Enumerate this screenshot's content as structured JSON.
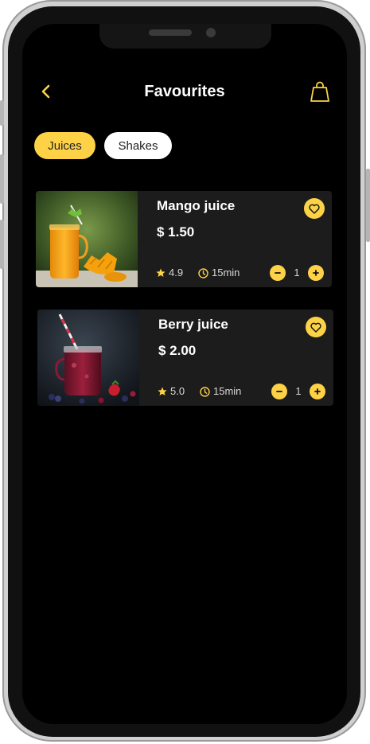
{
  "header": {
    "title": "Favourites",
    "back_icon": "chevron-left-icon",
    "bag_icon": "shopping-bag-icon"
  },
  "tabs": [
    {
      "label": "Juices",
      "active": true
    },
    {
      "label": "Shakes",
      "active": false
    }
  ],
  "favourites": [
    {
      "name": "Mango juice",
      "price": "$ 1.50",
      "rating": "4.9",
      "time": "15min",
      "quantity": "1",
      "image": "mango-juice-photo"
    },
    {
      "name": "Berry juice",
      "price": "$ 2.00",
      "rating": "5.0",
      "time": "15min",
      "quantity": "1",
      "image": "berry-juice-photo"
    }
  ],
  "colors": {
    "accent": "#fdd247",
    "background": "#000000",
    "card": "#1c1c1c",
    "text": "#ffffff"
  }
}
